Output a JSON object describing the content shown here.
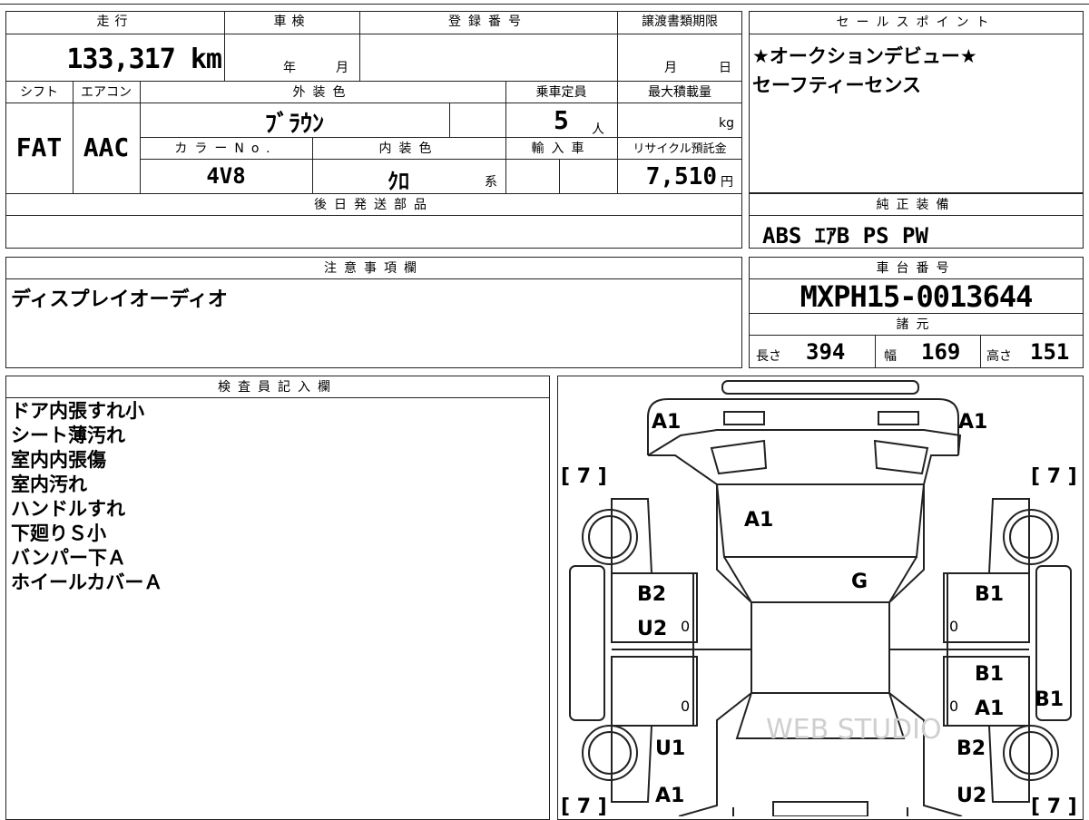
{
  "top_labels": {
    "mileage": "走行",
    "inspection": "車検",
    "registration_no": "登録番号",
    "transfer_deadline": "譲渡書類期限",
    "sales_point": "セールスポイント",
    "shift": "シフト",
    "aircon": "エアコン",
    "exterior_color": "外装色",
    "capacity": "乗車定員",
    "max_load": "最大積載量",
    "color_no": "カラーNo.",
    "interior_color": "内装色",
    "import_car": "輸入車",
    "recycle_fee": "リサイクル預託金",
    "later_parts": "後日発送部品",
    "standard_equipment": "純正装備",
    "notes": "注意事項欄",
    "chassis_no": "車台番号",
    "specs": "諸元",
    "inspector": "検査員記入欄"
  },
  "values": {
    "mileage": "133,317 km",
    "inspection_year_unit": "年",
    "inspection_month_unit": "月",
    "deadline_month_unit": "月",
    "deadline_day_unit": "日",
    "shift": "FAT",
    "aircon": "AAC",
    "exterior_color": "ﾌﾞﾗｳﾝ",
    "capacity": "5",
    "capacity_unit": "人",
    "max_load_unit": "kg",
    "color_no": "4V8",
    "interior_color": "ｸﾛ",
    "interior_color_suffix": "系",
    "recycle_fee": "7,510",
    "recycle_fee_unit": "円",
    "chassis_no": "MXPH15-0013644",
    "length_label": "長さ",
    "length": "394",
    "width_label": "幅",
    "width": "169",
    "height_label": "高さ",
    "height": "151"
  },
  "sales_points": [
    "★オークションデビュー★",
    "セーフティーセンス"
  ],
  "standard_equipment": "ABS ｴｱB PS PW",
  "notes": "ディスプレイオーディオ",
  "inspector_notes": [
    "ドア内張すれ小",
    "シート薄汚れ",
    "室内内張傷",
    "室内汚れ",
    "ハンドルすれ",
    "下廻りＳ小",
    "バンパー下Ａ",
    "ホイールカバーＡ"
  ],
  "diagram": {
    "marks": [
      "A1",
      "A1",
      "A1",
      "G",
      "B2",
      "U2",
      "B1",
      "B1",
      "A1",
      "B1",
      "U1",
      "B2",
      "A1",
      "U2"
    ],
    "zeros": [
      "0",
      "0",
      "0",
      "0"
    ],
    "tire_labels": [
      "[ 7 ]",
      "[ 7 ]",
      "[ 7 ]",
      "[ 7 ]"
    ],
    "watermark": "WEB STUDIO"
  }
}
